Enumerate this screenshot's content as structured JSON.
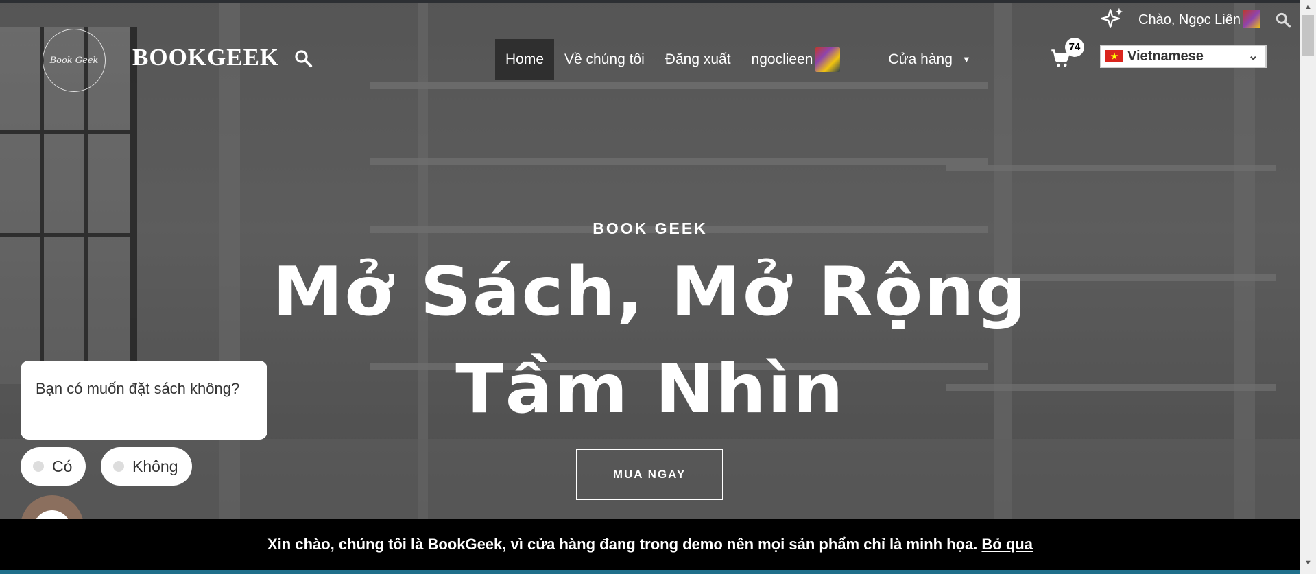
{
  "header": {
    "logo_text": "Book Geek",
    "brand": "BOOKGEEK",
    "nav": [
      {
        "label": "Home",
        "active": true
      },
      {
        "label": "Về chúng tôi"
      },
      {
        "label": "Đăng xuất"
      },
      {
        "label": "ngoclieen"
      },
      {
        "label": "Cửa hàng"
      }
    ],
    "cart_count": "74",
    "language": "Vietnamese",
    "greeting": "Chào, Ngọc Liên"
  },
  "hero": {
    "kicker": "BOOK GEEK",
    "headline_line1": "Mở Sách, Mở Rộng",
    "headline_line2": "Tầm Nhìn",
    "cta": "MUA NGAY"
  },
  "chat": {
    "question": "Bạn có muốn đặt sách không?",
    "options": [
      "Có",
      "Không"
    ]
  },
  "notice": {
    "text": "Xin chào, chúng tôi là BookGeek, vì cửa hàng đang trong demo nên mọi sản phẩm chỉ là minh họa.",
    "dismiss": "Bỏ qua"
  },
  "icons": {
    "search": "search-icon",
    "cart": "cart-icon",
    "sparkle": "sparkle-icon",
    "chevron": "chevron-down-icon",
    "chat": "chat-icon"
  },
  "colors": {
    "nav_active_bg": "#2f2f2f",
    "notice_bg": "#000000",
    "chat_launcher": "#8b6f5e",
    "flag": "#da251d"
  }
}
